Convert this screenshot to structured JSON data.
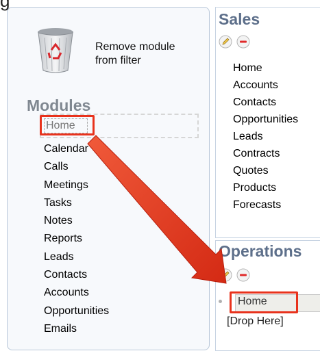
{
  "cut_heading": "g",
  "left_panel": {
    "remove_label_line1": "Remove module",
    "remove_label_line2": "from filter",
    "modules_heading": "Modules",
    "dragging_item": "Home",
    "modules": [
      "Calendar",
      "Calls",
      "Meetings",
      "Tasks",
      "Notes",
      "Reports",
      "Leads",
      "Contacts",
      "Accounts",
      "Opportunities",
      "Emails"
    ]
  },
  "sales_panel": {
    "title": "Sales",
    "items": [
      "Home",
      "Accounts",
      "Contacts",
      "Opportunities",
      "Leads",
      "Contracts",
      "Quotes",
      "Products",
      "Forecasts"
    ]
  },
  "ops_panel": {
    "title": "Operations",
    "dropped_item": "Home",
    "drop_here": "[Drop Here]"
  },
  "colors": {
    "highlight": "#e8321c",
    "heading_grey": "#808891",
    "panel_title": "#5d6f8a"
  },
  "icons": [
    "trash-recycle-icon",
    "pencil-edit-icon",
    "minus-remove-icon",
    "drag-arrow"
  ]
}
